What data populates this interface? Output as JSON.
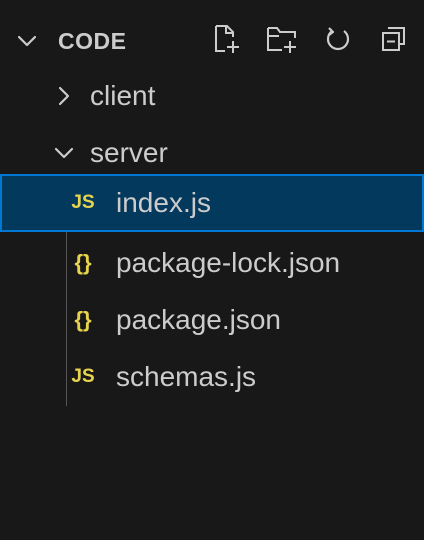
{
  "explorer": {
    "title": "CODE",
    "toolbar": {
      "new_file_icon": "new-file-icon",
      "new_folder_icon": "new-folder-icon",
      "refresh_icon": "refresh-icon",
      "collapse_icon": "collapse-all-icon"
    }
  },
  "tree": {
    "client": {
      "label": "client",
      "state": "collapsed"
    },
    "server": {
      "label": "server",
      "state": "expanded"
    },
    "files": [
      {
        "label": "index.js",
        "icon_text": "JS",
        "selected": true
      },
      {
        "label": "package-lock.json",
        "icon_text": "{}"
      },
      {
        "label": "package.json",
        "icon_text": "{}"
      },
      {
        "label": "schemas.js",
        "icon_text": "JS"
      }
    ]
  },
  "colors": {
    "background": "#181818",
    "text": "#cccccc",
    "selection": "#04395e",
    "selection_border": "#0078d4",
    "icon_yellow": "#e8d44d"
  }
}
